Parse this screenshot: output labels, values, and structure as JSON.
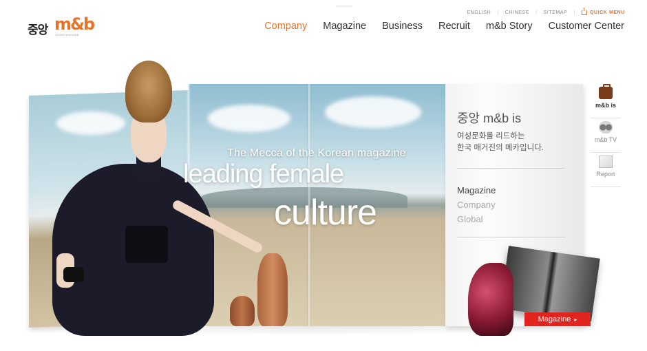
{
  "brand": {
    "logo_ko": "중앙",
    "logo_mb": "m&b",
    "logo_sub": "JOONGANGM&B",
    "accent_color": "#e8742a"
  },
  "utility": {
    "english": "ENGLISH",
    "chinese": "CHINESE",
    "sitemap": "SITEMAP",
    "quick_menu": "QUICK MENU"
  },
  "nav": {
    "items": [
      {
        "label": "Company",
        "active": true
      },
      {
        "label": "Magazine"
      },
      {
        "label": "Business"
      },
      {
        "label": "Recruit"
      },
      {
        "label": "m&b Story"
      },
      {
        "label": "Customer Center"
      }
    ]
  },
  "hero": {
    "tagline": "The Mecca of the Korean magazine",
    "headline_1": "leading female",
    "headline_2": "culture"
  },
  "info": {
    "title": "중앙 m&b is",
    "desc_line1": "여성문화를 리드하는",
    "desc_line2": "한국 매거진의 메카입니다.",
    "menu": [
      {
        "label": "Magazine",
        "active": true
      },
      {
        "label": "Company"
      },
      {
        "label": "Global"
      }
    ]
  },
  "side_tabs": [
    {
      "label": "m&b is",
      "icon": "briefcase-icon",
      "active": true
    },
    {
      "label": "m&b TV",
      "icon": "film-reel-icon"
    },
    {
      "label": "Report",
      "icon": "report-icon"
    }
  ],
  "magazine_button": {
    "label": "Magazine",
    "color": "#e1241e"
  }
}
